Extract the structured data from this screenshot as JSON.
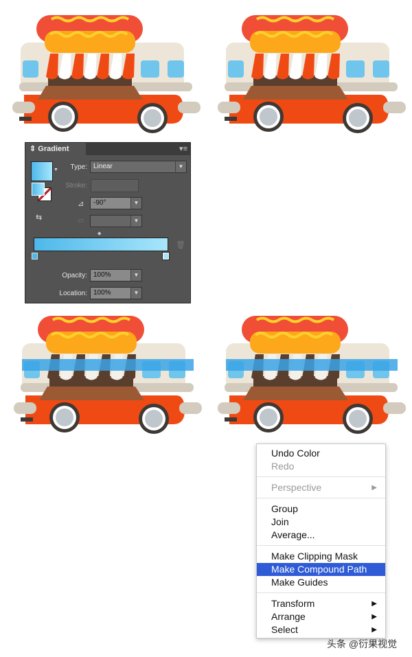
{
  "colors": {
    "sausage": "#f04e37",
    "bun": "#fda81a",
    "mustard": "#fdd12b",
    "cream": "#ede6d8",
    "body": "#f04a14",
    "counter": "#5a3e2e",
    "shelf": "#9b5a34",
    "bumper": "#d3cbbd",
    "wheel": "#3f3935",
    "hub": "#bfc6cc",
    "glass": "#6fc5ec",
    "highlight": "#2f5bd6"
  },
  "gradient_panel": {
    "title": "Gradient",
    "type_label": "Type:",
    "type_value": "Linear",
    "stroke_label": "Stroke:",
    "angle_value": "-90°",
    "opacity_label": "Opacity:",
    "opacity_value": "100%",
    "location_label": "Location:",
    "location_value": "100%",
    "gradient_start": "#4db8ea",
    "gradient_end": "#a8e6fb"
  },
  "context_menu": {
    "groups": [
      [
        {
          "label": "Undo Color",
          "enabled": true
        },
        {
          "label": "Redo",
          "enabled": false
        }
      ],
      [
        {
          "label": "Perspective",
          "enabled": false,
          "submenu": true
        }
      ],
      [
        {
          "label": "Group",
          "enabled": true
        },
        {
          "label": "Join",
          "enabled": true
        },
        {
          "label": "Average...",
          "enabled": true
        }
      ],
      [
        {
          "label": "Make Clipping Mask",
          "enabled": true
        },
        {
          "label": "Make Compound Path",
          "enabled": true,
          "selected": true
        },
        {
          "label": "Make Guides",
          "enabled": true
        }
      ],
      [
        {
          "label": "Transform",
          "enabled": true,
          "submenu": true
        },
        {
          "label": "Arrange",
          "enabled": true,
          "submenu": true
        },
        {
          "label": "Select",
          "enabled": true,
          "submenu": true
        }
      ]
    ]
  },
  "watermark": "头条 @衍果视觉"
}
